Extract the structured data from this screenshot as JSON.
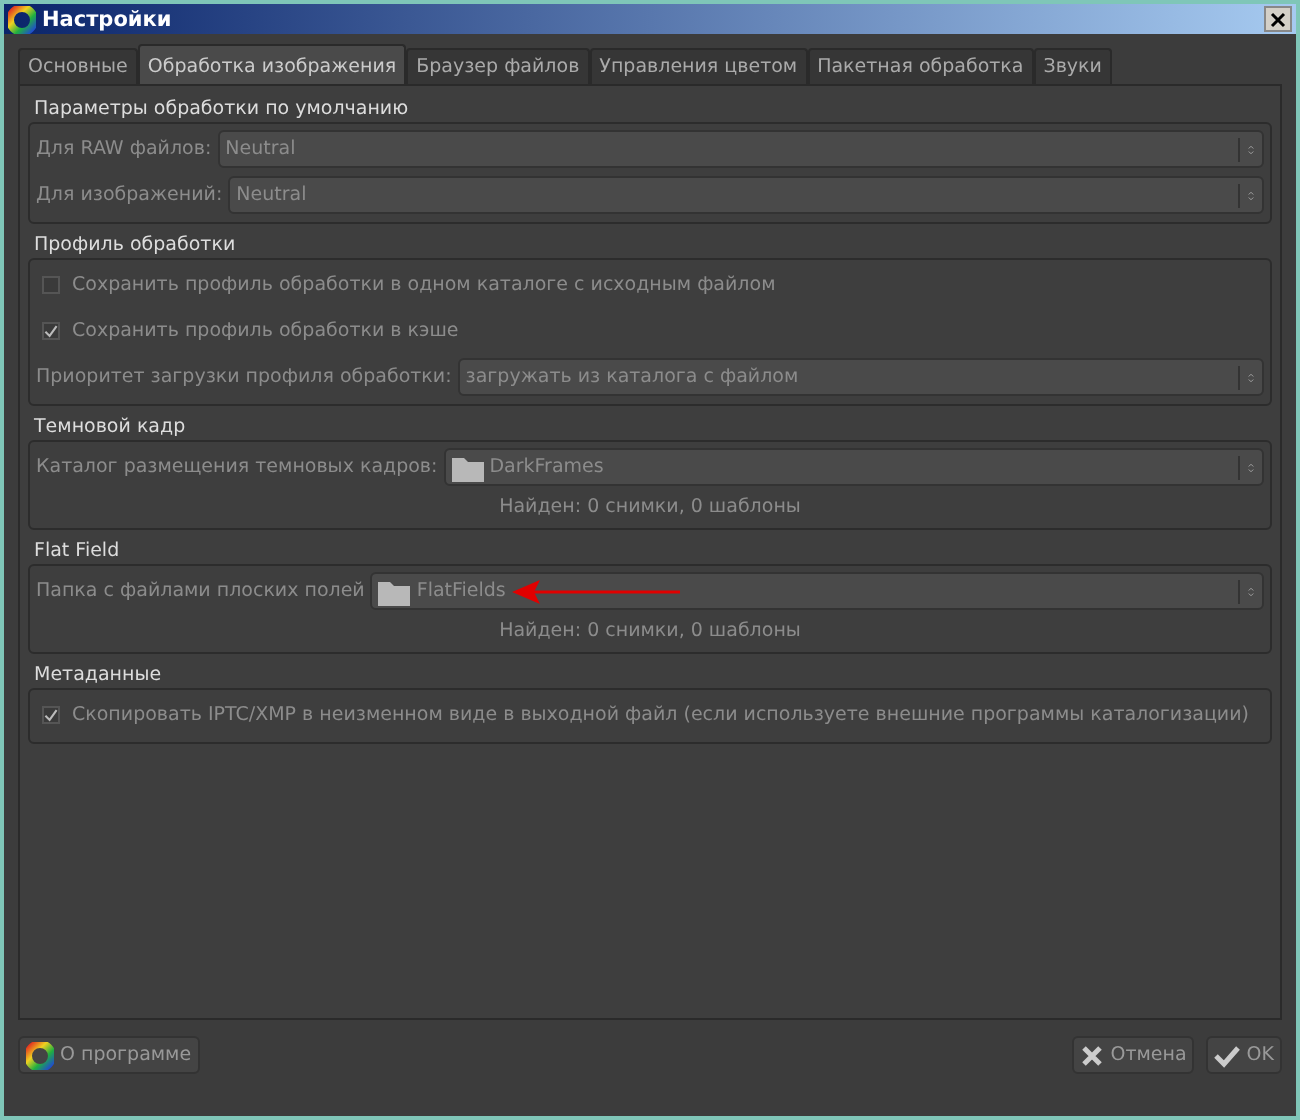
{
  "window": {
    "title": "Настройки"
  },
  "tabs": [
    {
      "label": "Основные",
      "selected": false
    },
    {
      "label": "Обработка изображения",
      "selected": true
    },
    {
      "label": "Браузер файлов",
      "selected": false
    },
    {
      "label": "Управления цветом",
      "selected": false
    },
    {
      "label": "Пакетная обработка",
      "selected": false
    },
    {
      "label": "Звуки",
      "selected": false
    }
  ],
  "sections": [
    {
      "title": "Параметры обработки по умолчанию",
      "rows": [
        {
          "kind": "combo",
          "label": "Для RAW файлов:",
          "value": "Neutral"
        },
        {
          "kind": "combo",
          "label": "Для изображений:",
          "value": "Neutral"
        }
      ]
    },
    {
      "title": "Профиль обработки",
      "rows": [
        {
          "kind": "checkbox",
          "label": "Сохранить профиль обработки в одном каталоге с исходным файлом",
          "checked": false
        },
        {
          "kind": "checkbox",
          "label": "Сохранить профиль обработки в кэше",
          "checked": true
        },
        {
          "kind": "combo",
          "label": "Приоритет загрузки профиля обработки:",
          "value": "загружать из каталога с файлом"
        }
      ]
    },
    {
      "title": "Темновой кадр",
      "rows": [
        {
          "kind": "folder",
          "label": "Каталог размещения темновых кадров:",
          "value": "DarkFrames",
          "arrow": false
        },
        {
          "kind": "note",
          "text": "Найден: 0 снимки, 0 шаблоны"
        }
      ]
    },
    {
      "title": "Flat Field",
      "rows": [
        {
          "kind": "folder",
          "label": "Папка с файлами плоских полей",
          "value": "FlatFields",
          "arrow": true
        },
        {
          "kind": "note",
          "text": "Найден: 0 снимки, 0 шаблоны"
        }
      ]
    },
    {
      "title": "Метаданные",
      "rows": [
        {
          "kind": "checkbox",
          "label": "Скопировать IPTC/XMP в неизменном виде в выходной файл (если используете внешние программы каталогизации)",
          "checked": true
        }
      ]
    }
  ],
  "buttons": [
    {
      "kind": "about",
      "label": "О программе"
    },
    {
      "kind": "cancel",
      "label": "Отмена"
    },
    {
      "kind": "ok",
      "label": "OK"
    }
  ]
}
